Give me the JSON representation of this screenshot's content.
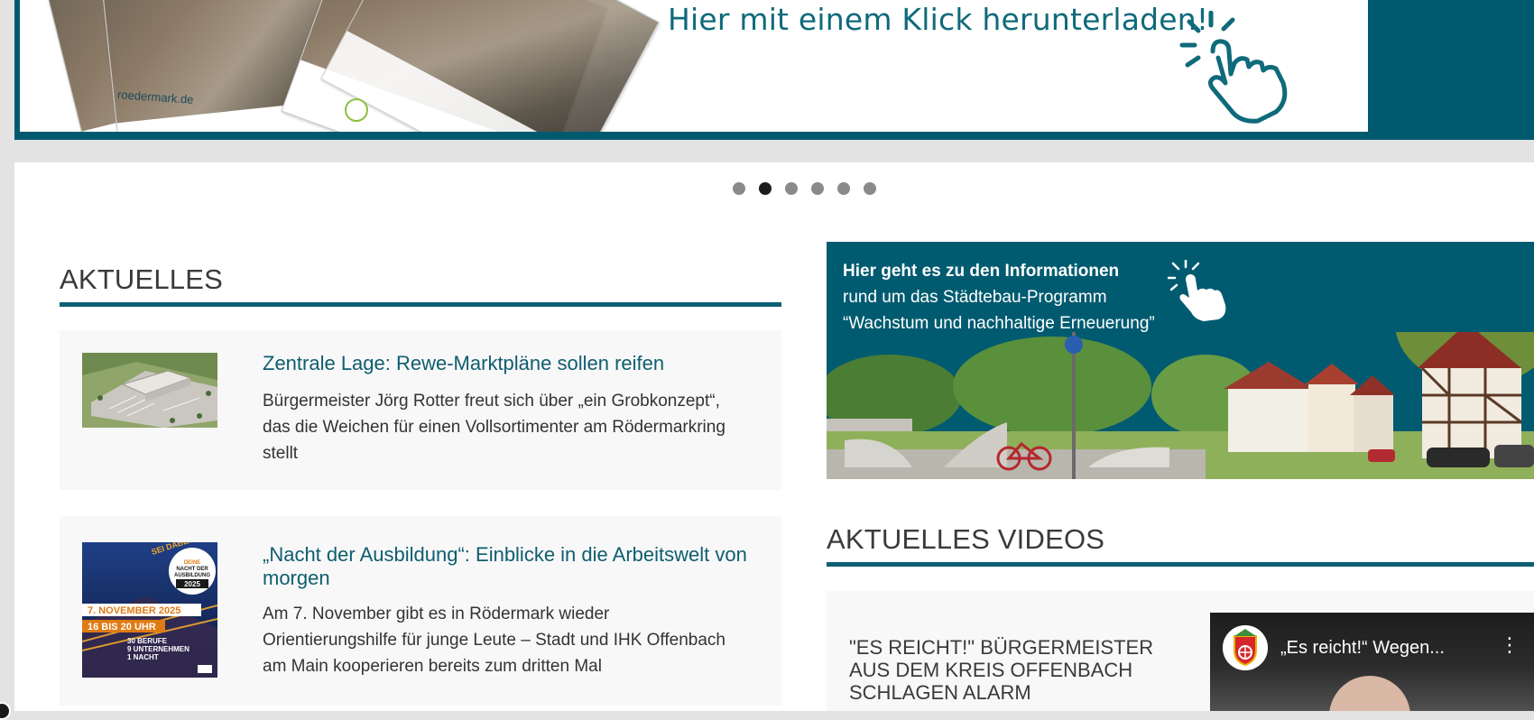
{
  "banner": {
    "cta_text": "Hier mit einem Klick herunterladen!",
    "brochure_site": "roedermark.de",
    "icon": "tap-hand-icon"
  },
  "slider": {
    "dot_count": 6,
    "active_index": 1
  },
  "aktuelles": {
    "title": "AKTUELLES",
    "items": [
      {
        "headline": "Zentrale Lage: Rewe-Marktpläne sollen reifen",
        "teaser_lines": [
          "Bürgermeister Jörg Rotter freut sich über „ein Grobkonzept“,",
          "das die Weichen für einen Vollsortimenter am Rödermarkring",
          "stellt"
        ]
      },
      {
        "headline_lines": [
          "„Nacht der Ausbildung“: Einblicke in die Arbeitswelt von",
          "morgen"
        ],
        "teaser_lines": [
          "Am 7. November gibt es in Rödermark wieder",
          "Orientierungshilfe für junge Leute – Stadt und IHK Offenbach",
          "am Main kooperieren bereits zum dritten Mal"
        ],
        "thumb": {
          "badge_top": "SEI DABEI!",
          "badge_lines": [
            "DEINE",
            "NACHT DER",
            "AUSBILDUNG",
            "2025"
          ],
          "date": "7. NOVEMBER 2025",
          "time": "16 BIS 20 UHR",
          "stats": [
            "30 BERUFE",
            "9 UNTERNEHMEN",
            "1 NACHT"
          ]
        }
      }
    ]
  },
  "promo": {
    "line1": "Hier geht es zu den Informationen",
    "line2": "rund um das Städtebau-Programm",
    "line3": "“Wachstum und nachhaltige Erneuerung”",
    "icon": "tap-hand-icon"
  },
  "videos": {
    "title": "AKTUELLES VIDEOS",
    "item": {
      "title_lines": [
        "\"ES REICHT!\" BÜRGERMEISTER",
        "AUS DEM KREIS OFFENBACH",
        "SCHLAGEN ALARM"
      ],
      "embed_title": "„Es reicht!“ Wegen...",
      "menu_icon": "more-vertical-icon"
    }
  },
  "colors": {
    "accent": "#0e5f73",
    "banner_bg": "#005a6f",
    "promo_bg": "#005b70",
    "card_bg": "#f8f8f8",
    "page_bg": "#e3e3e3"
  }
}
